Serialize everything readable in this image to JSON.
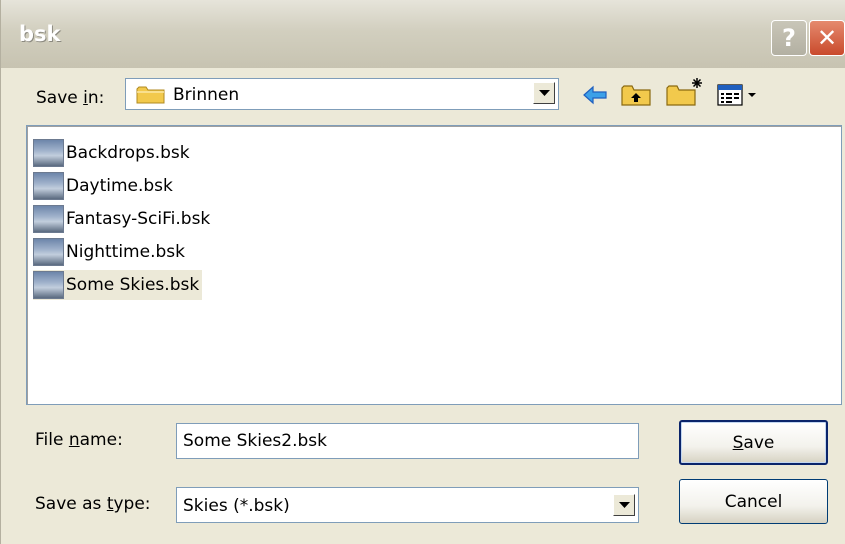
{
  "window": {
    "title": "bsk",
    "help_glyph": "?",
    "close_glyph": "✕"
  },
  "save_in": {
    "label_pre": "Save ",
    "label_ul": "i",
    "label_post": "n:",
    "value": "Brinnen"
  },
  "toolbar": {
    "icons": [
      "back-arrow-icon",
      "up-folder-icon",
      "new-folder-icon",
      "view-menu-icon"
    ]
  },
  "files": [
    {
      "name": "Backdrops.bsk",
      "selected": false
    },
    {
      "name": "Daytime.bsk",
      "selected": false
    },
    {
      "name": "Fantasy-SciFi.bsk",
      "selected": false
    },
    {
      "name": "Nighttime.bsk",
      "selected": false
    },
    {
      "name": "Some Skies.bsk",
      "selected": true
    }
  ],
  "file_name": {
    "label_pre": "File ",
    "label_ul": "n",
    "label_post": "ame:",
    "value": "Some Skies2.bsk"
  },
  "save_as_type": {
    "label_pre": "Save as ",
    "label_ul": "t",
    "label_post": "ype:",
    "value": "Skies (*.bsk)"
  },
  "buttons": {
    "save_ul": "S",
    "save_rest": "ave",
    "cancel": "Cancel"
  },
  "colors": {
    "dialog_bg": "#ece9d8",
    "accent_yellow": "#f2c94c",
    "arrow_blue": "#1f5fbf"
  }
}
